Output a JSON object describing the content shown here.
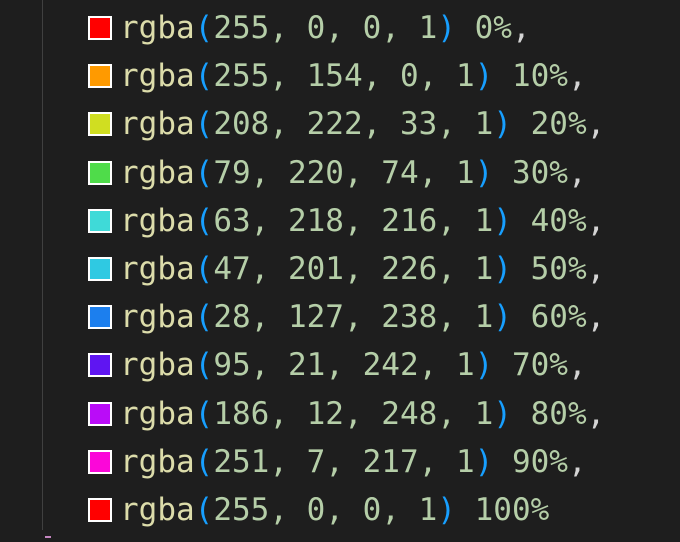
{
  "editor": {
    "lines": [
      {
        "swatch": "#ff0000",
        "fn": "rgba",
        "open": "(",
        "args": "255, 0, 0, 1",
        "close": ")",
        "stop": "0%",
        "trail": ","
      },
      {
        "swatch": "#ff9a00",
        "fn": "rgba",
        "open": "(",
        "args": "255, 154, 0, 1",
        "close": ")",
        "stop": "10%",
        "trail": ","
      },
      {
        "swatch": "#d0de21",
        "fn": "rgba",
        "open": "(",
        "args": "208, 222, 33, 1",
        "close": ")",
        "stop": "20%",
        "trail": ","
      },
      {
        "swatch": "#4fdc4a",
        "fn": "rgba",
        "open": "(",
        "args": "79, 220, 74, 1",
        "close": ")",
        "stop": "30%",
        "trail": ","
      },
      {
        "swatch": "#3fdad8",
        "fn": "rgba",
        "open": "(",
        "args": "63, 218, 216, 1",
        "close": ")",
        "stop": "40%",
        "trail": ","
      },
      {
        "swatch": "#2fc9e2",
        "fn": "rgba",
        "open": "(",
        "args": "47, 201, 226, 1",
        "close": ")",
        "stop": "50%",
        "trail": ","
      },
      {
        "swatch": "#1c7fee",
        "fn": "rgba",
        "open": "(",
        "args": "28, 127, 238, 1",
        "close": ")",
        "stop": "60%",
        "trail": ","
      },
      {
        "swatch": "#5f15f2",
        "fn": "rgba",
        "open": "(",
        "args": "95, 21, 242, 1",
        "close": ")",
        "stop": "70%",
        "trail": ","
      },
      {
        "swatch": "#ba0cf8",
        "fn": "rgba",
        "open": "(",
        "args": "186, 12, 248, 1",
        "close": ")",
        "stop": "80%",
        "trail": ","
      },
      {
        "swatch": "#fb07d9",
        "fn": "rgba",
        "open": "(",
        "args": "251, 7, 217, 1",
        "close": ")",
        "stop": "90%",
        "trail": ","
      },
      {
        "swatch": "#ff0000",
        "fn": "rgba",
        "open": "(",
        "args": "255, 0, 0, 1",
        "close": ")",
        "stop": "100%",
        "trail": ""
      }
    ]
  },
  "colors": {
    "background": "#1e1e1e",
    "function": "#dcdcaa",
    "paren": "#179fff",
    "number": "#b5cea8",
    "punctuation": "#d4d4d4"
  }
}
